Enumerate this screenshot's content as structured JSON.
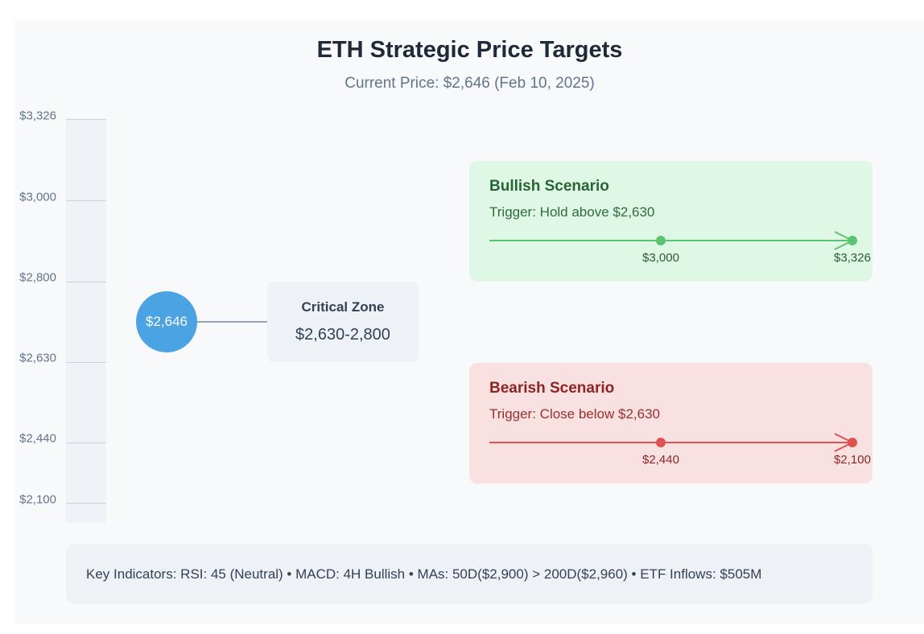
{
  "title": "ETH Strategic Price Targets",
  "subtitle": "Current Price: $2,646 (Feb 10, 2025)",
  "price_axis": {
    "ticks": [
      "$3,326",
      "$3,000",
      "$2,800",
      "$2,630",
      "$2,440",
      "$2,100"
    ]
  },
  "current_price": "$2,646",
  "critical_zone": {
    "title": "Critical Zone",
    "range": "$2,630-2,800"
  },
  "bullish": {
    "title": "Bullish Scenario",
    "trigger": "Trigger: Hold above $2,630",
    "targets": [
      "$3,000",
      "$3,326"
    ],
    "color": "#5cc46e"
  },
  "bearish": {
    "title": "Bearish Scenario",
    "trigger": "Trigger: Close below $2,630",
    "targets": [
      "$2,440",
      "$2,100"
    ],
    "color": "#e05252"
  },
  "indicators": "Key Indicators: RSI: 45 (Neutral) • MACD: 4H Bullish • MAs: 50D($2,900) > 200D($2,960) • ETF Inflows: $505M"
}
